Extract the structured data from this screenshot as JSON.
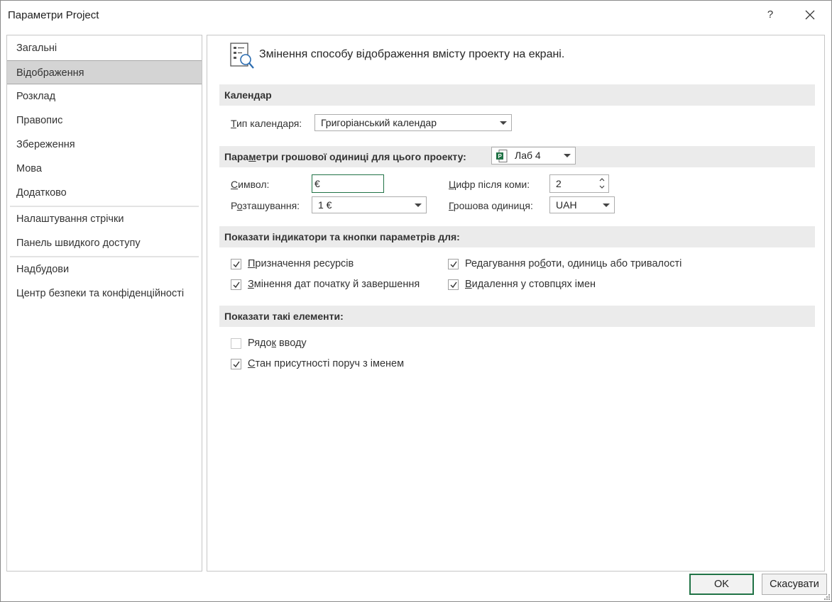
{
  "window": {
    "title": "Параметри Project",
    "help_label": "?"
  },
  "sidebar": {
    "items": [
      {
        "label": "Загальні"
      },
      {
        "label": "Відображення",
        "active": true
      },
      {
        "label": "Розклад"
      },
      {
        "label": "Правопис"
      },
      {
        "label": "Збереження"
      },
      {
        "label": "Мова"
      },
      {
        "label": "Додатково"
      },
      {
        "label": "Налаштування стрічки"
      },
      {
        "label": "Панель швидкого доступу"
      },
      {
        "label": "Надбудови"
      },
      {
        "label": "Центр безпеки та конфіденційності"
      }
    ]
  },
  "main": {
    "header": "Змінення способу відображення вмісту проекту на екрані.",
    "calendar": {
      "section_title": "Календар",
      "type_label_underlined": "Т",
      "type_label_rest": "ип календаря:",
      "type_value": "Григоріанський календар"
    },
    "currency": {
      "section_title_a": "Пара",
      "section_title_u": "м",
      "section_title_b": "етри грошової одиниці для цього проекту:",
      "project_value": "Лаб 4",
      "symbol_label_u": "С",
      "symbol_label_rest": "имвол:",
      "symbol_value": "€",
      "placement_label_a": "Р",
      "placement_label_u": "о",
      "placement_label_b": "зташування:",
      "placement_value": "1 €",
      "decimals_label_u": "Ц",
      "decimals_label_rest": "ифр після коми:",
      "decimals_value": "2",
      "currency_label_u": "Г",
      "currency_label_rest": "рошова одиниця:",
      "currency_value": "UAH"
    },
    "indicators": {
      "section_title": "Показати індикатори та кнопки параметрів для:",
      "items": [
        {
          "label_u": "П",
          "label_rest": "ризначення ресурсів",
          "checked": true
        },
        {
          "label_a": "Редагування ро",
          "label_u": "б",
          "label_rest": "оти, одиниць або тривалості",
          "checked": true
        },
        {
          "label_u": "З",
          "label_rest": "мінення дат початку й завершення",
          "checked": true
        },
        {
          "label_u": "В",
          "label_rest": "идалення у стовпцях імен",
          "checked": true
        }
      ]
    },
    "elements": {
      "section_title": "Показати такі елементи:",
      "items": [
        {
          "label_a": "Рядо",
          "label_u": "к",
          "label_rest": " вводу",
          "checked": false
        },
        {
          "label_u": "С",
          "label_rest": "тан присутності поруч з іменем",
          "checked": true
        }
      ]
    }
  },
  "footer": {
    "ok_label": "OK",
    "cancel_label": "Скасувати"
  },
  "colors": {
    "accent": "#217346",
    "active_nav": "#d4d4d4",
    "section_bg": "#ebebeb"
  }
}
